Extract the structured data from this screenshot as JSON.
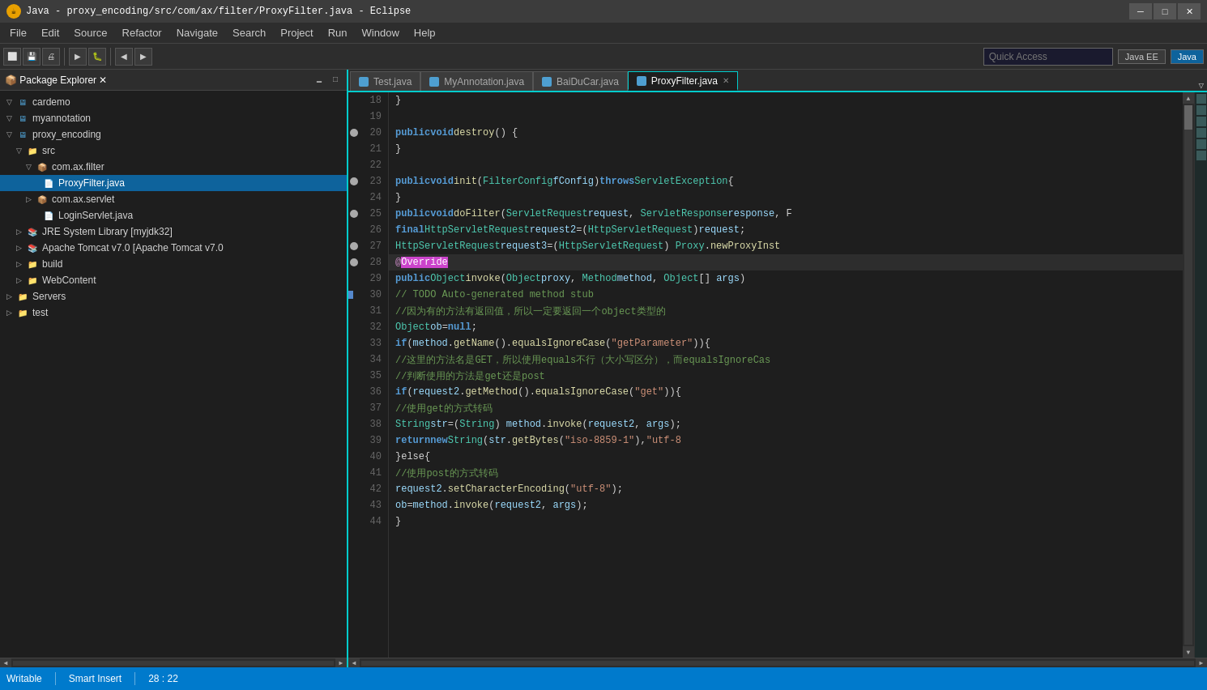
{
  "titleBar": {
    "title": "Java - proxy_encoding/src/com/ax/filter/ProxyFilter.java - Eclipse",
    "appIcon": "☕",
    "minimize": "─",
    "maximize": "□",
    "close": "✕"
  },
  "menuBar": {
    "items": [
      "File",
      "Edit",
      "Source",
      "Refactor",
      "Navigate",
      "Search",
      "Project",
      "Run",
      "Window",
      "Help"
    ]
  },
  "toolbar": {
    "quickAccess": "Quick Access",
    "perspectives": [
      "Java EE",
      "Java"
    ]
  },
  "packageExplorer": {
    "title": "Package Explorer",
    "tree": [
      {
        "id": "cardemo",
        "label": "cardemo",
        "level": 0,
        "type": "project",
        "expanded": true
      },
      {
        "id": "myannotation",
        "label": "myannotation",
        "level": 0,
        "type": "project",
        "expanded": true
      },
      {
        "id": "proxy_encoding",
        "label": "proxy_encoding",
        "level": 0,
        "type": "project",
        "expanded": true
      },
      {
        "id": "src",
        "label": "src",
        "level": 1,
        "type": "folder",
        "expanded": true
      },
      {
        "id": "com.ax.filter",
        "label": "com.ax.filter",
        "level": 2,
        "type": "package",
        "expanded": true
      },
      {
        "id": "ProxyFilter.java",
        "label": "ProxyFilter.java",
        "level": 3,
        "type": "java",
        "selected": true
      },
      {
        "id": "com.ax.servlet",
        "label": "com.ax.servlet",
        "level": 2,
        "type": "package",
        "expanded": true
      },
      {
        "id": "LoginServlet.java",
        "label": "LoginServlet.java",
        "level": 3,
        "type": "java"
      },
      {
        "id": "JRE",
        "label": "JRE System Library [myjdk32]",
        "level": 1,
        "type": "lib"
      },
      {
        "id": "Tomcat",
        "label": "Apache Tomcat v7.0 [Apache Tomcat v7.0",
        "level": 1,
        "type": "lib"
      },
      {
        "id": "build",
        "label": "build",
        "level": 1,
        "type": "folder"
      },
      {
        "id": "WebContent",
        "label": "WebContent",
        "level": 1,
        "type": "folder"
      },
      {
        "id": "Servers",
        "label": "Servers",
        "level": 0,
        "type": "folder"
      },
      {
        "id": "test",
        "label": "test",
        "level": 0,
        "type": "folder"
      }
    ]
  },
  "editorTabs": [
    {
      "id": "test-java",
      "label": "Test.java",
      "active": false,
      "color": "#4e9fd1"
    },
    {
      "id": "myannotation-java",
      "label": "MyAnnotation.java",
      "active": false,
      "color": "#4e9fd1"
    },
    {
      "id": "baiducar-java",
      "label": "BaiDuCar.java",
      "active": false,
      "color": "#4e9fd1"
    },
    {
      "id": "proxyfilter-java",
      "label": "ProxyFilter.java",
      "active": true,
      "color": "#4e9fd1",
      "closeable": true
    }
  ],
  "codeLines": [
    {
      "num": 18,
      "content": "        }",
      "hasBookmark": false,
      "hasBreakpoint": false
    },
    {
      "num": 19,
      "content": "",
      "hasBookmark": false,
      "hasBreakpoint": false
    },
    {
      "num": 20,
      "content": "    public void destroy() {",
      "hasBookmark": true,
      "hasBreakpoint": false
    },
    {
      "num": 21,
      "content": "        }",
      "hasBookmark": false,
      "hasBreakpoint": false
    },
    {
      "num": 22,
      "content": "",
      "hasBookmark": false,
      "hasBreakpoint": false
    },
    {
      "num": 23,
      "content": "    public void init(FilterConfig fConfig) throws ServletException {",
      "hasBookmark": true,
      "hasBreakpoint": false
    },
    {
      "num": 24,
      "content": "        }",
      "hasBookmark": false,
      "hasBreakpoint": false
    },
    {
      "num": 25,
      "content": "    public void doFilter(ServletRequest request, ServletResponse response, F",
      "hasBookmark": true,
      "hasBreakpoint": false
    },
    {
      "num": 26,
      "content": "        final HttpServletRequest request2=(HttpServletRequest)request;",
      "hasBookmark": false,
      "hasBreakpoint": false
    },
    {
      "num": 27,
      "content": "        HttpServletRequest request3=(HttpServletRequest) Proxy.newProxyInst",
      "hasBookmark": true,
      "hasBreakpoint": false
    },
    {
      "num": 28,
      "content": "        @[HIGHLIGHT]",
      "hasBookmark": false,
      "hasBreakpoint": false,
      "isCurrentLine": true
    },
    {
      "num": 29,
      "content": "        public Object invoke(Object proxy, Method method, Object[] args)",
      "hasBookmark": false,
      "hasBreakpoint": false
    },
    {
      "num": 30,
      "content": "            // TODO Auto-generated method stub",
      "hasBookmark": true,
      "hasBreakpoint": false
    },
    {
      "num": 31,
      "content": "            //因为有的方法有返回值，所以一定要返回一个object类型的",
      "hasBookmark": false,
      "hasBreakpoint": false
    },
    {
      "num": 32,
      "content": "            Object ob=null;",
      "hasBookmark": false,
      "hasBreakpoint": false
    },
    {
      "num": 33,
      "content": "            if(method.getName().equalsIgnoreCase(\"getParameter\")){",
      "hasBookmark": false,
      "hasBreakpoint": false
    },
    {
      "num": 34,
      "content": "                //这里的方法名是GET，所以使用equals不行（大小写区分），而equalsIgnoreCas",
      "hasBookmark": false,
      "hasBreakpoint": false
    },
    {
      "num": 35,
      "content": "                //判断使用的方法是get还是post",
      "hasBookmark": false,
      "hasBreakpoint": false
    },
    {
      "num": 36,
      "content": "                if(request2.getMethod().equalsIgnoreCase(\"get\")){",
      "hasBookmark": false,
      "hasBreakpoint": false
    },
    {
      "num": 37,
      "content": "                    //使用get的方式转码",
      "hasBookmark": false,
      "hasBreakpoint": false
    },
    {
      "num": 38,
      "content": "                    String str=(String) method.invoke(request2, args);",
      "hasBookmark": false,
      "hasBreakpoint": false
    },
    {
      "num": 39,
      "content": "                    return new String(str.getBytes(\"iso-8859-1\"),\"utf-8",
      "hasBookmark": false,
      "hasBreakpoint": false
    },
    {
      "num": 40,
      "content": "                }else{",
      "hasBookmark": false,
      "hasBreakpoint": false
    },
    {
      "num": 41,
      "content": "                    //使用post的方式转码",
      "hasBookmark": false,
      "hasBreakpoint": false
    },
    {
      "num": 42,
      "content": "                    request2.setCharacterEncoding(\"utf-8\");",
      "hasBookmark": false,
      "hasBreakpoint": false
    },
    {
      "num": 43,
      "content": "                    ob=method.invoke(request2, args);",
      "hasBookmark": false,
      "hasBreakpoint": false
    },
    {
      "num": 44,
      "content": "                }",
      "hasBookmark": false,
      "hasBreakpoint": false
    }
  ],
  "statusBar": {
    "writable": "Writable",
    "insertMode": "Smart Insert",
    "position": "28 : 22"
  }
}
